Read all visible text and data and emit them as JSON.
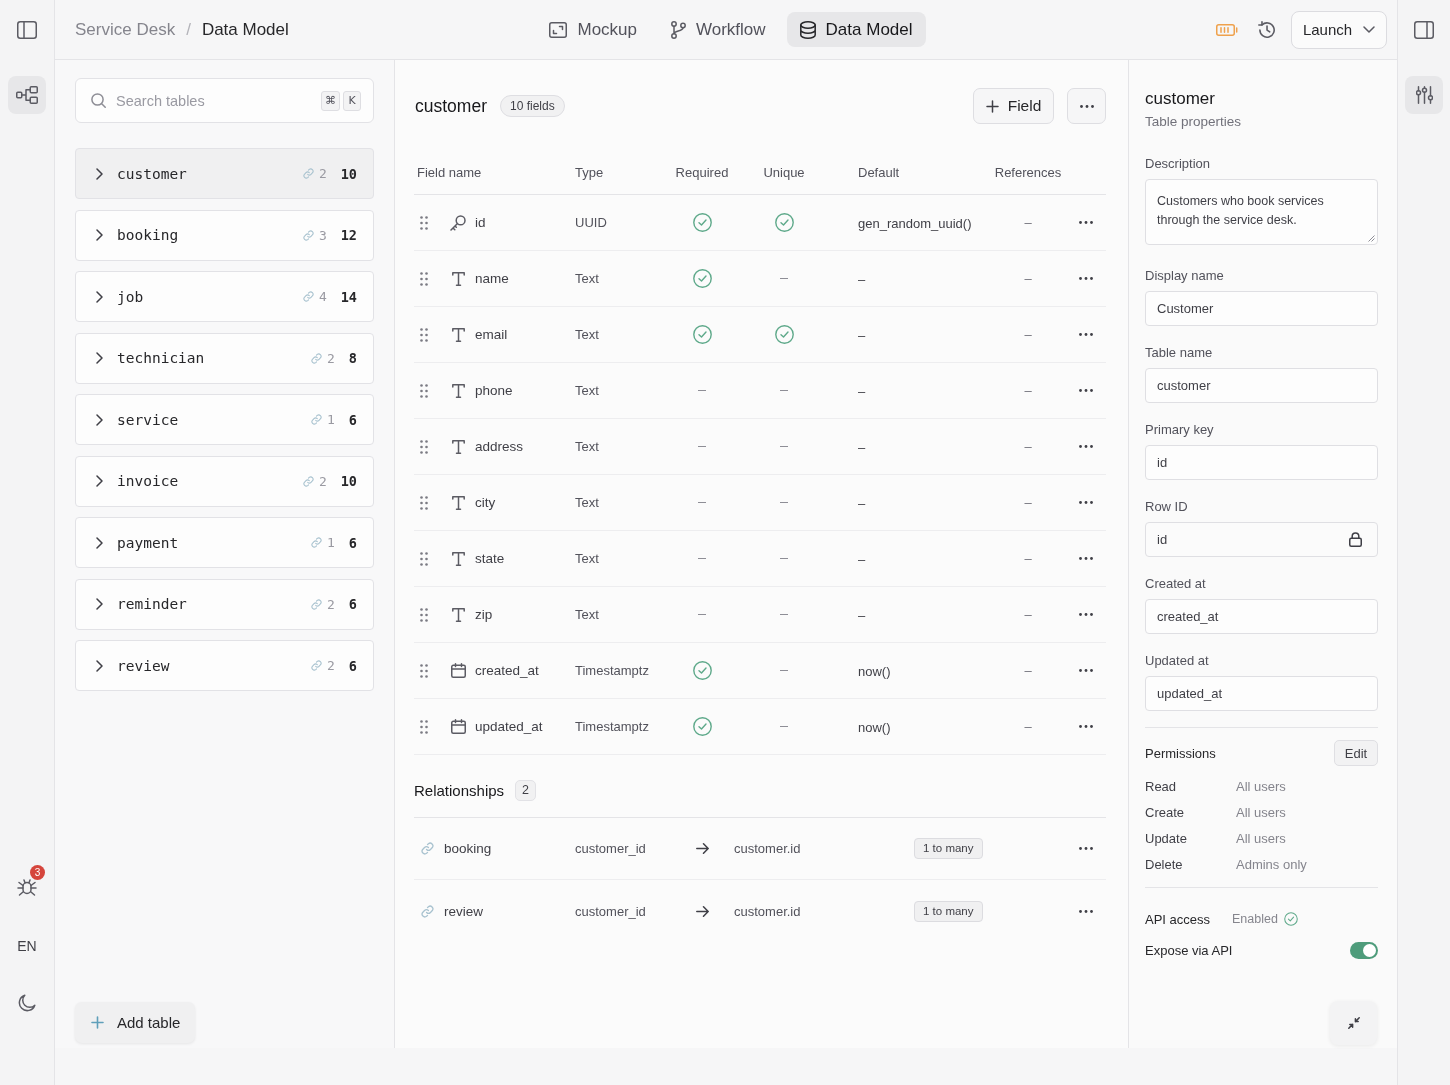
{
  "left_rail": {
    "tools": [
      {
        "selected": true
      }
    ],
    "notifications": "3",
    "language": "EN"
  },
  "breadcrumb": {
    "items": [
      "Service Desk",
      "Data Model"
    ],
    "separator": "/"
  },
  "view_tabs": [
    {
      "label": "Mockup",
      "selected": false
    },
    {
      "label": "Workflow",
      "selected": false
    },
    {
      "label": "Data Model",
      "selected": true
    }
  ],
  "launch_button": "Launch",
  "right_rail": {
    "tools": [
      {
        "selected": true
      }
    ]
  },
  "table_search": {
    "placeholder": "Search tables",
    "shortcut": [
      "⌘",
      "K"
    ]
  },
  "tables": [
    {
      "name": "customer",
      "links": "2",
      "fields": "10",
      "selected": true
    },
    {
      "name": "booking",
      "links": "3",
      "fields": "12",
      "selected": false
    },
    {
      "name": "job",
      "links": "4",
      "fields": "14",
      "selected": false
    },
    {
      "name": "technician",
      "links": "2",
      "fields": "8",
      "selected": false
    },
    {
      "name": "service",
      "links": "1",
      "fields": "6",
      "selected": false
    },
    {
      "name": "invoice",
      "links": "2",
      "fields": "10",
      "selected": false
    },
    {
      "name": "payment",
      "links": "1",
      "fields": "6",
      "selected": false
    },
    {
      "name": "reminder",
      "links": "2",
      "fields": "6",
      "selected": false
    },
    {
      "name": "review",
      "links": "2",
      "fields": "6",
      "selected": false
    }
  ],
  "add_table": "Add table",
  "detail": {
    "title": "customer",
    "badge": "10 fields",
    "add_field": "Field",
    "columns": [
      "Field name",
      "Type",
      "Required",
      "Unique",
      "Default",
      "References"
    ],
    "fields": [
      {
        "kind": "key",
        "name": "id",
        "type": "UUID",
        "required": true,
        "unique": true,
        "default": "gen_random_uuid()",
        "references": "–"
      },
      {
        "kind": "text",
        "name": "name",
        "type": "Text",
        "required": true,
        "unique": false,
        "default": "–",
        "references": "–"
      },
      {
        "kind": "text",
        "name": "email",
        "type": "Text",
        "required": true,
        "unique": true,
        "default": "–",
        "references": "–"
      },
      {
        "kind": "text",
        "name": "phone",
        "type": "Text",
        "required": false,
        "unique": false,
        "default": "–",
        "references": "–"
      },
      {
        "kind": "text",
        "name": "address",
        "type": "Text",
        "required": false,
        "unique": false,
        "default": "–",
        "references": "–"
      },
      {
        "kind": "text",
        "name": "city",
        "type": "Text",
        "required": false,
        "unique": false,
        "default": "–",
        "references": "–"
      },
      {
        "kind": "text",
        "name": "state",
        "type": "Text",
        "required": false,
        "unique": false,
        "default": "–",
        "references": "–"
      },
      {
        "kind": "text",
        "name": "zip",
        "type": "Text",
        "required": false,
        "unique": false,
        "default": "–",
        "references": "–"
      },
      {
        "kind": "timestamp",
        "name": "created_at",
        "type": "Timestamptz",
        "required": true,
        "unique": false,
        "default": "now()",
        "references": "–"
      },
      {
        "kind": "timestamp",
        "name": "updated_at",
        "type": "Timestamptz",
        "required": true,
        "unique": false,
        "default": "now()",
        "references": "–"
      }
    ]
  },
  "relationships": {
    "title": "Relationships",
    "count": "2",
    "rows": [
      {
        "table": "booking",
        "column": "customer_id",
        "target": "customer.id",
        "cardinality": "1 to many"
      },
      {
        "table": "review",
        "column": "customer_id",
        "target": "customer.id",
        "cardinality": "1 to many"
      }
    ]
  },
  "properties": {
    "title": "customer",
    "subtitle": "Table properties",
    "description": {
      "label": "Description",
      "value": "Customers who book services through the service desk."
    },
    "fields": [
      {
        "label": "Display name",
        "value": "Customer",
        "locked": false
      },
      {
        "label": "Table name",
        "value": "customer",
        "locked": false
      },
      {
        "label": "Primary key",
        "value": "id",
        "locked": false
      },
      {
        "label": "Row ID",
        "value": "id",
        "locked": true
      },
      {
        "label": "Created at",
        "value": "created_at",
        "locked": false
      },
      {
        "label": "Updated at",
        "value": "updated_at",
        "locked": false
      }
    ],
    "permissions": {
      "title": "Permissions",
      "edit": "Edit",
      "rows": [
        {
          "action": "Read",
          "audience": "All users"
        },
        {
          "action": "Create",
          "audience": "All users"
        },
        {
          "action": "Update",
          "audience": "All users"
        },
        {
          "action": "Delete",
          "audience": "Admins only"
        }
      ]
    },
    "api": {
      "label": "API access",
      "status": "Enabled",
      "expose_label": "Expose via API",
      "expose": true
    }
  }
}
